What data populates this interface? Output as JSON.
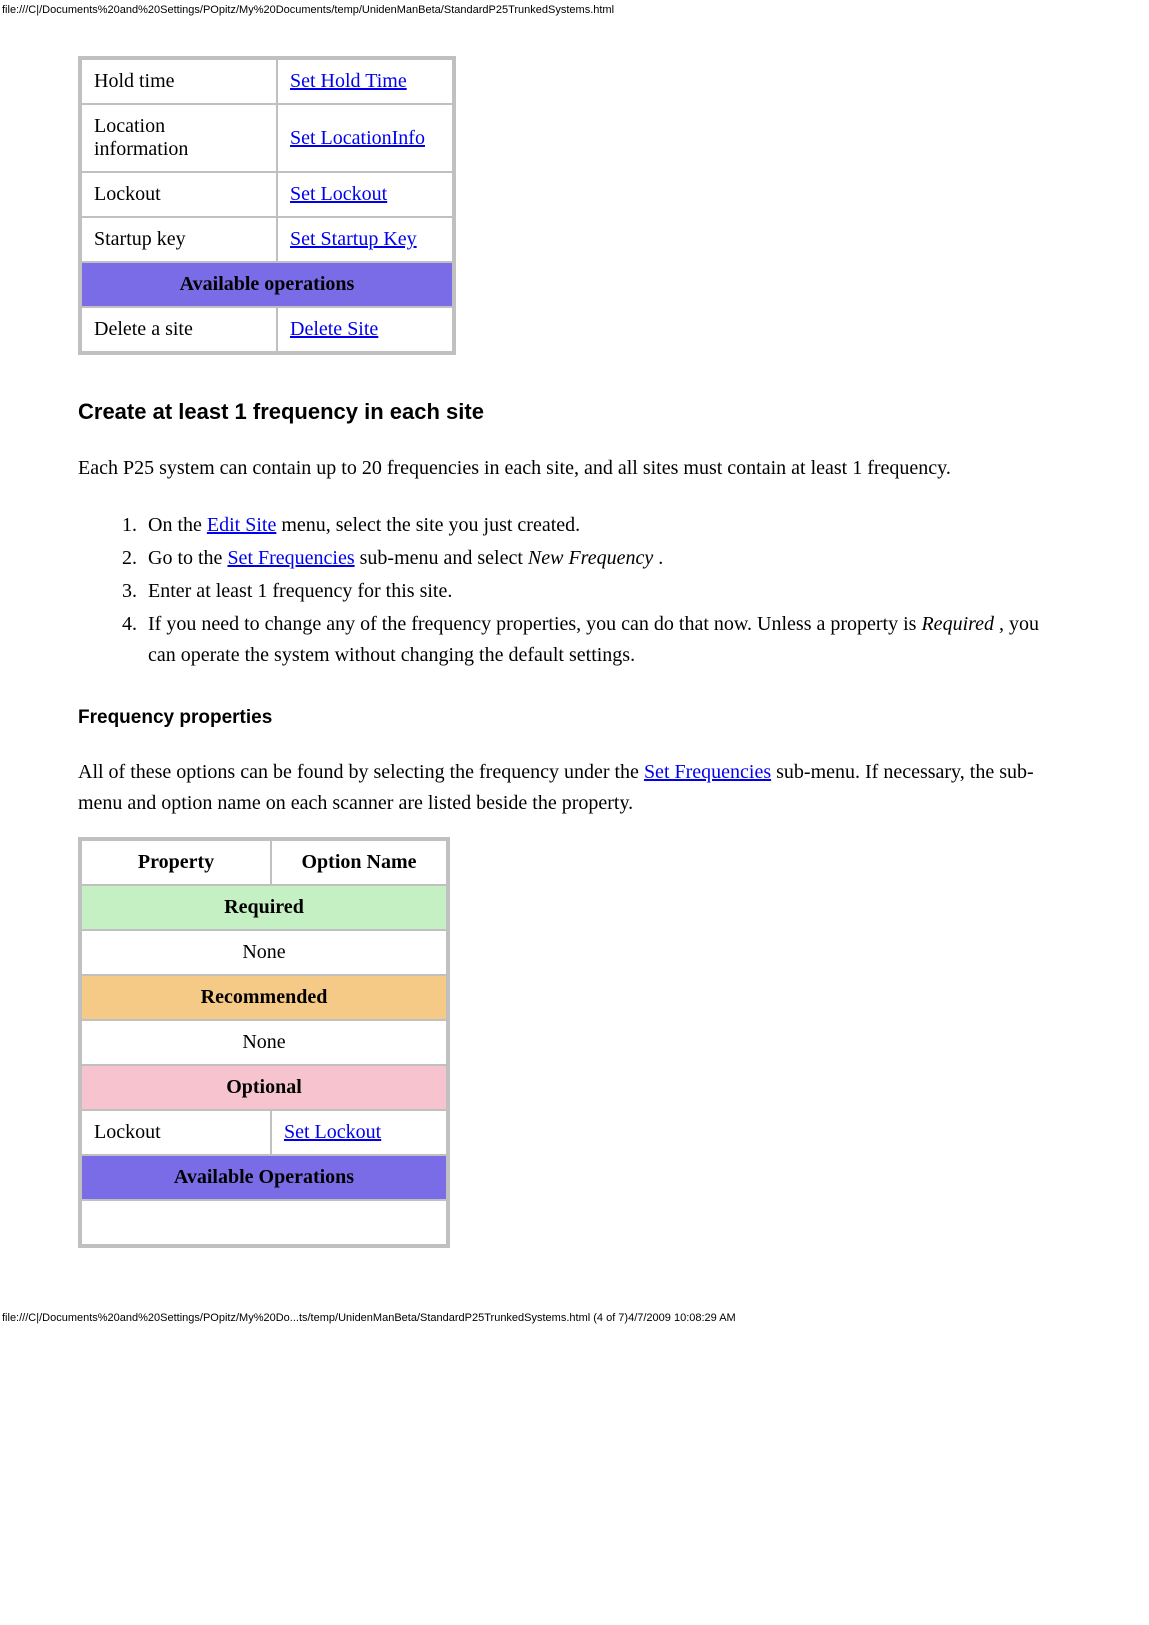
{
  "header_url": "file:///C|/Documents%20and%20Settings/POpitz/My%20Documents/temp/UnidenManBeta/StandardP25TrunkedSystems.html",
  "footer_url": "file:///C|/Documents%20and%20Settings/POpitz/My%20Do...ts/temp/UnidenManBeta/StandardP25TrunkedSystems.html (4 of 7)4/7/2009 10:08:29 AM",
  "table1": {
    "rows": [
      {
        "prop": "Hold time",
        "link": "Set Hold Time"
      },
      {
        "prop": "Location information",
        "link": "Set LocationInfo"
      },
      {
        "prop": "Lockout",
        "link": "Set Lockout"
      },
      {
        "prop": "Startup key",
        "link": "Set Startup Key"
      }
    ],
    "section": "Available operations",
    "op_row": {
      "prop": "Delete a site",
      "link": "Delete Site"
    }
  },
  "h3": "Create at least 1 frequency in each site",
  "para1": "Each P25 system can contain up to 20 frequencies in each site, and all sites must contain at least 1 frequency.",
  "steps": {
    "s1a": "On the ",
    "s1link": "Edit Site",
    "s1b": " menu, select the site you just created.",
    "s2a": "Go to the ",
    "s2link": "Set Frequencies",
    "s2b": " sub-menu and select ",
    "s2em": "New Frequency",
    "s2c": " .",
    "s3": "Enter at least 1 frequency for this site.",
    "s4a": "If you need to change any of the frequency properties, you can do that now. Unless a property is ",
    "s4em": "Required",
    "s4b": " , you can operate the system without changing the default settings."
  },
  "h4": "Frequency properties",
  "para2a": "All of these options can be found by selecting the frequency under the ",
  "para2link": "Set Frequencies",
  "para2b": " sub-menu. If necessary, the sub-menu and option name on each scanner are listed beside the property.",
  "table2": {
    "head1": "Property",
    "head2": "Option Name",
    "required": "Required",
    "none1": "None",
    "recommended": "Recommended",
    "none2": "None",
    "optional": "Optional",
    "opt_row": {
      "prop": "Lockout",
      "link": "Set Lockout"
    },
    "avail": "Available Operations"
  }
}
